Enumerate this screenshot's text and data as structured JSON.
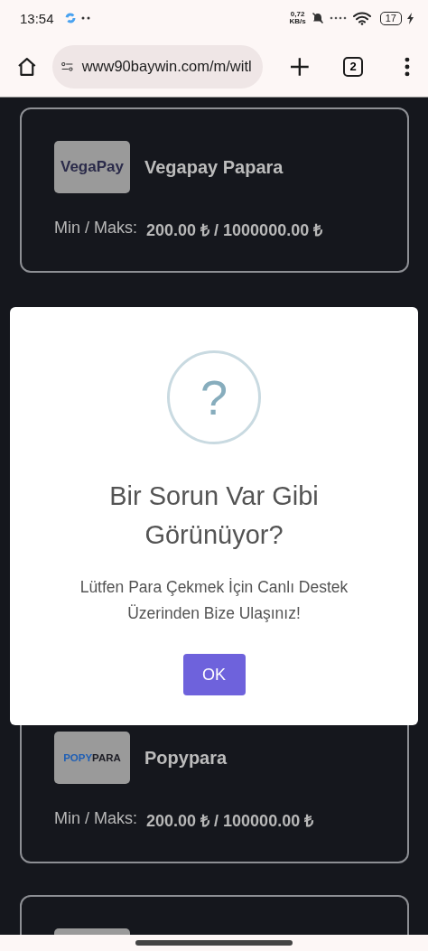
{
  "status_bar": {
    "time": "13:54",
    "speed_value": "0,72",
    "speed_unit": "KB/s",
    "battery": "17"
  },
  "browser": {
    "url": "www90baywin.com/m/witl",
    "tab_count": "2"
  },
  "cards": [
    {
      "kind": "full",
      "logo": [
        {
          "text": "VegaPay",
          "color": "#2b2b4a"
        }
      ],
      "name": "Vegapay Papara",
      "label": "Min / Maks:",
      "amount": "200.00 ₺ / 1000000.00 ₺"
    },
    {
      "kind": "spacer"
    },
    {
      "kind": "full",
      "logo": [
        {
          "text": "POPY",
          "color": "#1f5fb5"
        },
        {
          "text": "PARA",
          "color": "#1c1c24"
        }
      ],
      "name": "Popypara",
      "label": "Min / Maks:",
      "amount": "200.00 ₺ / 100000.00 ₺"
    },
    {
      "kind": "cut"
    }
  ],
  "dialog": {
    "icon": "?",
    "title": "Bir Sorun Var Gibi Görünüyor?",
    "message": "Lütfen Para Çekmek İçin Canlı Destek Üzerinden Bize Ulaşınız!",
    "button": "OK"
  }
}
